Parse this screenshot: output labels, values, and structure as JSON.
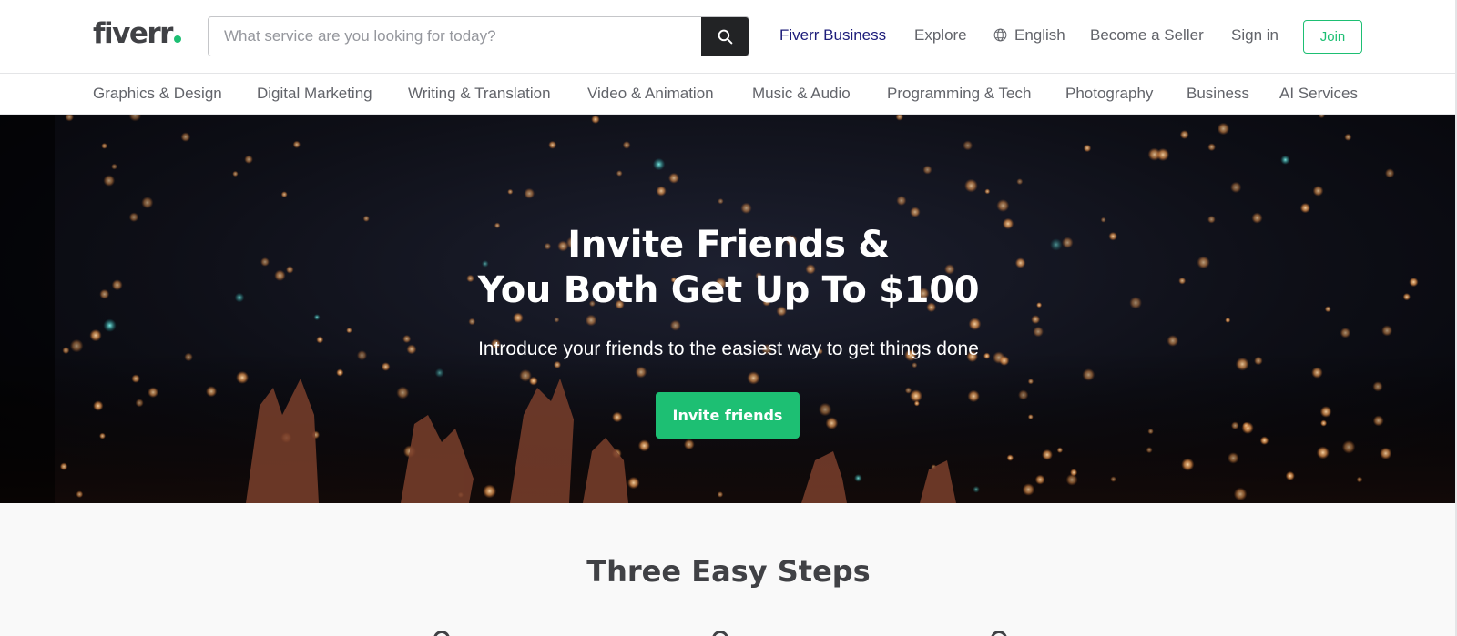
{
  "header": {
    "logo": "fiverr",
    "search": {
      "placeholder": "What service are you looking for today?",
      "value": ""
    },
    "nav": {
      "business": "Fiverr Business",
      "explore": "Explore",
      "language": "English",
      "become_seller": "Become a Seller",
      "sign_in": "Sign in",
      "join": "Join"
    }
  },
  "categories": [
    "Graphics & Design",
    "Digital Marketing",
    "Writing & Translation",
    "Video & Animation",
    "Music & Audio",
    "Programming & Tech",
    "Photography",
    "Business",
    "AI Services"
  ],
  "hero": {
    "title_line1": "Invite Friends &",
    "title_line2": "You Both Get Up To $100",
    "subtitle": "Introduce your friends to the easiest way to get things done",
    "cta": "Invite friends"
  },
  "steps": {
    "title": "Three Easy Steps"
  },
  "colors": {
    "brand_green": "#1dbf73",
    "business_navy": "#1d1d7a",
    "text_dark": "#404145",
    "text_gray": "#62646a"
  }
}
